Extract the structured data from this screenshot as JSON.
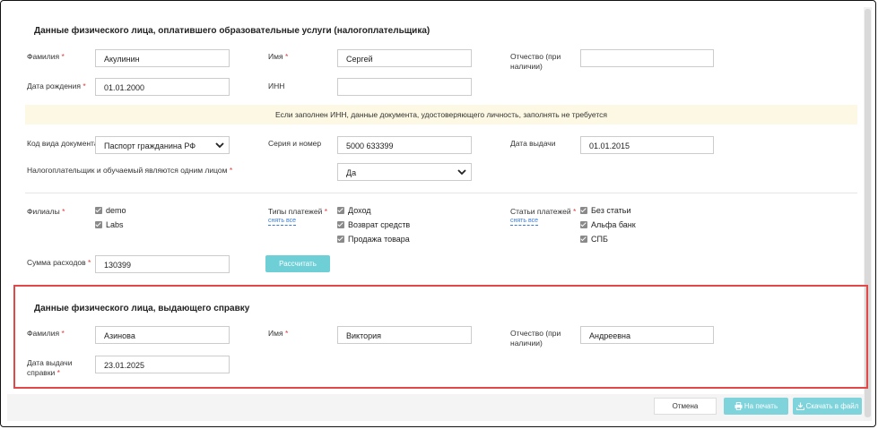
{
  "taxpayer_section": {
    "title": "Данные физического лица, оплатившего образовательные услуги (налогоплательщика)",
    "last_name_label": "Фамилия",
    "last_name_value": "Акулинин",
    "first_name_label": "Имя",
    "first_name_value": "Сергей",
    "middle_name_label_1": "Отчество (при",
    "middle_name_label_2": "наличии)",
    "middle_name_value": "",
    "birth_date_label": "Дата рождения",
    "birth_date_value": "01.01.2000",
    "inn_label": "ИНН",
    "inn_value": "",
    "notice": "Если заполнен ИНН, данные документа, удостоверяющего личность, заполнять не требуется",
    "doc_type_label": "Код вида документа",
    "doc_type_value": "Паспорт гражданина РФ",
    "series_number_label": "Серия и номер",
    "series_number_value": "5000 633399",
    "issue_date_label": "Дата выдачи",
    "issue_date_value": "01.01.2015",
    "same_person_label": "Налогоплательщик и обучаемый являются одним лицом",
    "same_person_value": "Да"
  },
  "filters": {
    "branches_label": "Филиалы",
    "branches": [
      "demo",
      "Labs"
    ],
    "payment_types_label": "Типы платежей",
    "payment_types_clear": "снять все",
    "payment_types": [
      "Доход",
      "Возврат средств",
      "Продажа товара"
    ],
    "payment_items_label": "Статьи платежей",
    "payment_items_clear": "снять все",
    "payment_items": [
      "Без статьи",
      "Альфа банк",
      "СПБ"
    ],
    "expenses_label": "Сумма расходов",
    "expenses_value": "130399",
    "calculate_button": "Рассчитать"
  },
  "issuer_section": {
    "title": "Данные физического лица, выдающего справку",
    "last_name_label": "Фамилия",
    "last_name_value": "Азинова",
    "first_name_label": "Имя",
    "first_name_value": "Виктория",
    "middle_name_label_1": "Отчество (при",
    "middle_name_label_2": "наличии)",
    "middle_name_value": "Андреевна",
    "issue_date_label_1": "Дата выдачи",
    "issue_date_label_2": "справки",
    "issue_date_value": "23.01.2025"
  },
  "footer": {
    "cancel_button": "Отмена",
    "print_button": "На печать",
    "download_button": "Скачать в файл"
  },
  "colors": {
    "required": "#e03b3b",
    "teal_button": "#6fcfd6",
    "notice_bg": "#fcf8e3",
    "highlight_border": "#e24848",
    "link": "#3a7bd5"
  },
  "icons": {
    "print": "printer-icon",
    "download": "download-icon",
    "select": "chevron-down-icon",
    "checkbox": "check-icon"
  }
}
